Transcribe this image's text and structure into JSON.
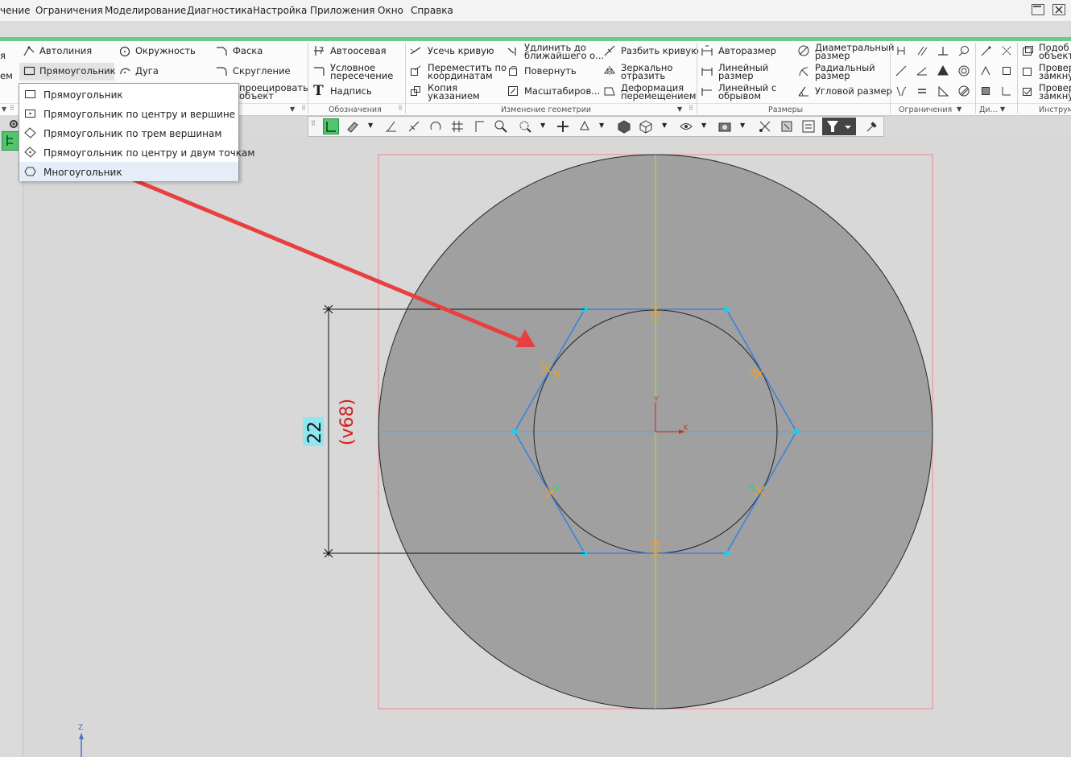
{
  "menu": [
    "чение",
    "Ограничения",
    "Моделирование",
    "Диагностика",
    "Настройка",
    "Приложения",
    "Окно",
    "Справка"
  ],
  "ribbon": {
    "left_cut": [
      "я",
      "ем"
    ],
    "draw": {
      "autoline": "Автолиния",
      "circle": "Окружность",
      "chamfer": "Фаска",
      "rectangle": "Прямоугольник",
      "arc": "Дуга",
      "fillet": "Скругление",
      "project_1": "проецировать",
      "project_2": "объект"
    },
    "annotations": {
      "autoaxis": "Автоосевая",
      "cond_1": "Условное",
      "cond_2": "пересечение",
      "text": "Надпись",
      "group": "Обозначения"
    },
    "geometry": {
      "trim": "Усечь кривую",
      "extend_1": "Удлинить до",
      "extend_2": "ближайшего о...",
      "split": "Разбить кривую",
      "move_1": "Переместить по",
      "move_2": "координатам",
      "rotate": "Повернуть",
      "mirror_1": "Зеркально",
      "mirror_2": "отразить",
      "copy_1": "Копия",
      "copy_2": "указанием",
      "scale": "Масштабиров...",
      "deform_1": "Деформация",
      "deform_2": "перемещением",
      "group": "Изменение геометрии"
    },
    "dimensions": {
      "auto": "Авторазмер",
      "diam_1": "Диаметральный",
      "diam_2": "размер",
      "linear_1": "Линейный",
      "linear_2": "размер",
      "radial_1": "Радиальный",
      "radial_2": "размер",
      "break_1": "Линейный с",
      "break_2": "обрывом",
      "angular": "Угловой размер",
      "group": "Размеры"
    },
    "constraints_group": "Ограничения",
    "di_group": "Ди...",
    "tools": {
      "similar_1": "Подоб",
      "similar_2": "объект",
      "check1_1": "Провер",
      "check1_2": "замкну",
      "check2_1": "Провер",
      "check2_2": "замкну",
      "group": "Инструм"
    }
  },
  "dropdown": [
    "Прямоугольник",
    "Прямоугольник по центру и вершине",
    "Прямоугольник по трем вершинам",
    "Прямоугольник по центру и двум точкам",
    "Многоугольник"
  ],
  "dimension": {
    "value": "22",
    "variable": "(v68)"
  },
  "axes": {
    "x": "X",
    "y": "Y",
    "z": "Z"
  },
  "colors": {
    "menu_bg": "#f3f3f3",
    "accent_stripe": "#6dcb8a",
    "part_fill": "#a0a0a0",
    "hexagon": "#3a82e0",
    "vertex": "#18d0e8",
    "centerline_vertical": "#b6d94a",
    "centerline_horizontal": "#4ea8e0",
    "constraint": "#f0a020",
    "arrow": "#e84040",
    "dimension_var": "#d42020",
    "dimension_box": "#8ee6f0"
  }
}
